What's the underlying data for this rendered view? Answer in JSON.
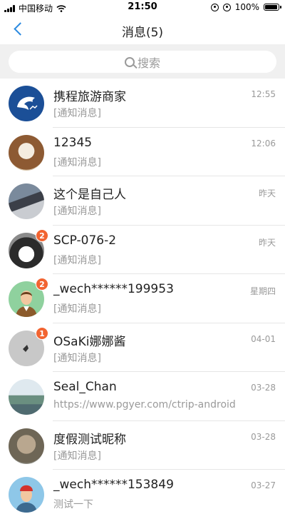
{
  "status": {
    "carrier": "中国移动",
    "time": "21:50",
    "battery": "100%"
  },
  "nav": {
    "title": "消息(5)"
  },
  "search": {
    "placeholder": "搜索"
  },
  "messages": [
    {
      "name": "携程旅游商家",
      "sub": "[通知消息]",
      "time": "12:55",
      "badge": "",
      "avatar": "ctrip-logo"
    },
    {
      "name": "12345",
      "sub": "[通知消息]",
      "time": "12:06",
      "badge": "",
      "avatar": "dog-photo"
    },
    {
      "name": "这个是自己人",
      "sub": "[通知消息]",
      "time": "昨天",
      "badge": "",
      "avatar": "desk-photo"
    },
    {
      "name": "SCP-076-2",
      "sub": "[通知消息]",
      "time": "昨天",
      "badge": "2",
      "avatar": "husky-photo"
    },
    {
      "name": "_wech******199953",
      "sub": "[通知消息]",
      "time": "星期四",
      "badge": "2",
      "avatar": "default-man-avatar"
    },
    {
      "name": "OSaKi娜娜酱",
      "sub": "[通知消息]",
      "time": "04-01",
      "badge": "1",
      "avatar": "gray-photo"
    },
    {
      "name": "Seal_Chan",
      "sub": "https://www.pgyer.com/ctrip-android",
      "time": "03-28",
      "badge": "",
      "avatar": "sea-photo"
    },
    {
      "name": "度假测试昵称",
      "sub": "[通知消息]",
      "time": "03-28",
      "badge": "",
      "avatar": "statue-photo"
    },
    {
      "name": "_wech******153849",
      "sub": "测试一下",
      "time": "03-27",
      "badge": "",
      "avatar": "default-man-red-hat-avatar"
    }
  ],
  "colors": {
    "accent": "#2b8ae0",
    "badge": "#f26431"
  }
}
